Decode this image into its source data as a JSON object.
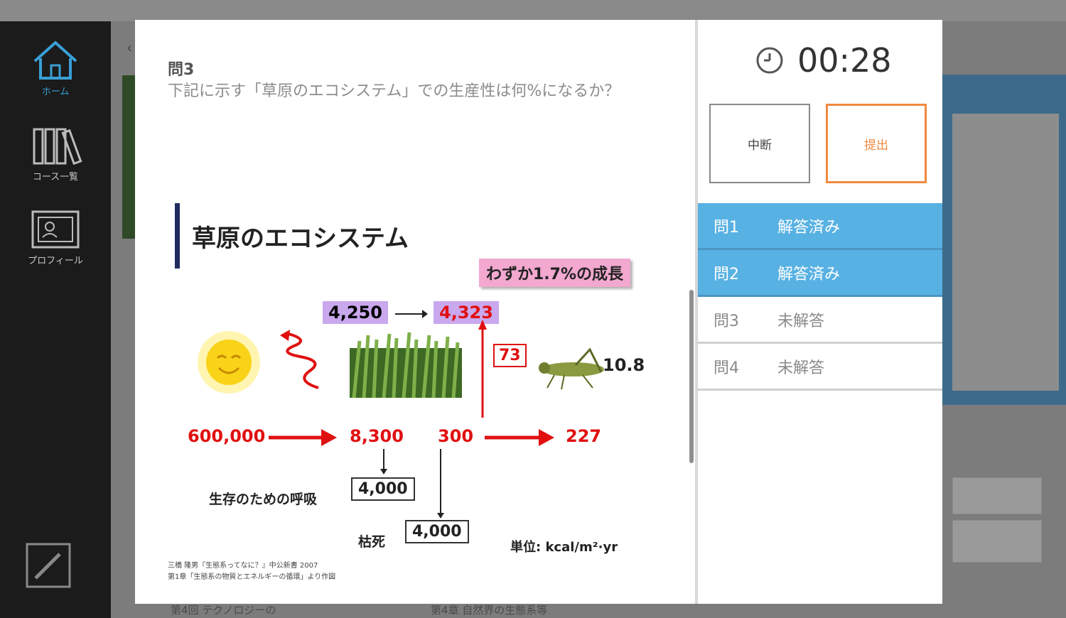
{
  "sidebar": {
    "items": [
      {
        "label": "ホーム",
        "icon": "home-icon"
      },
      {
        "label": "コース一覧",
        "icon": "books-icon"
      },
      {
        "label": "プロフィール",
        "icon": "profile-icon"
      }
    ],
    "edit_icon": "edit-icon"
  },
  "background": {
    "footer_items": [
      "第4回 テクノロジーの",
      "第4章 自然界の生態系等"
    ]
  },
  "question": {
    "title": "問3",
    "text": "下記に示す「草原のエコシステム」での生産性は何%になるか？"
  },
  "figure": {
    "title": "草原のエコシステム",
    "note": "わずか1.7%の成長",
    "before": "4,250",
    "after": "4,323",
    "sun_energy": "600,000",
    "plant_energy": "8,300",
    "plant_to_insect": "300",
    "insect_energy": "227",
    "growth_box": "73",
    "insect_value": "10.8",
    "respiration_label": "生存のための呼吸",
    "respiration_value": "4,000",
    "death_label": "枯死",
    "death_value": "4,000",
    "unit": "単位: kcal/m²·yr",
    "cite_1": "三橋 隆男『生態系ってなに？』中公新書 2007",
    "cite_2": "第1章「生態系の物質とエネルギーの循環」より作図"
  },
  "timer": {
    "icon": "clock-icon",
    "value": "00:28"
  },
  "actions": {
    "pause": "中断",
    "submit": "提出"
  },
  "questions": [
    {
      "num": "問1",
      "status": "解答済み",
      "state": "done"
    },
    {
      "num": "問2",
      "status": "解答済み",
      "state": "done"
    },
    {
      "num": "問3",
      "status": "未解答",
      "state": "todo"
    },
    {
      "num": "問4",
      "status": "未解答",
      "state": "todo"
    }
  ],
  "colors": {
    "accent_blue": "#58b1e3",
    "submit_orange": "#f08a40",
    "sidebar_bg": "#1b1b1b"
  }
}
